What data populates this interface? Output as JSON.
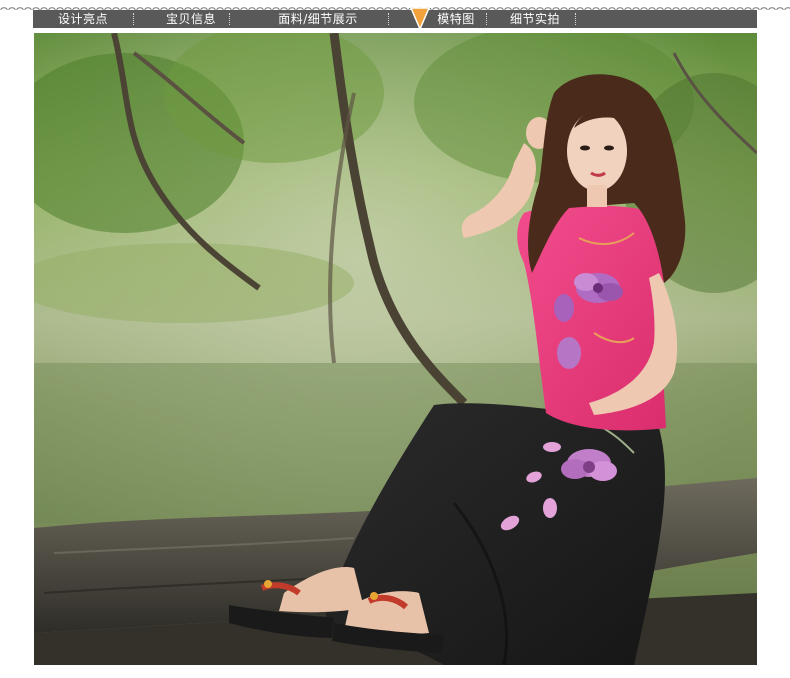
{
  "nav": {
    "tabs": [
      {
        "label": "设计亮点"
      },
      {
        "label": "宝贝信息"
      },
      {
        "label": "面料/细节展示"
      },
      {
        "label": "模特图",
        "active": true
      },
      {
        "label": "细节实拍"
      }
    ],
    "active_index": 3
  },
  "colors": {
    "nav_bg": "#595959",
    "nav_text": "#ffffff",
    "active_arrow": "#f2a23a",
    "chain": "#777777"
  },
  "photo": {
    "subject": "model-photo",
    "icon": "model-photo-image"
  }
}
